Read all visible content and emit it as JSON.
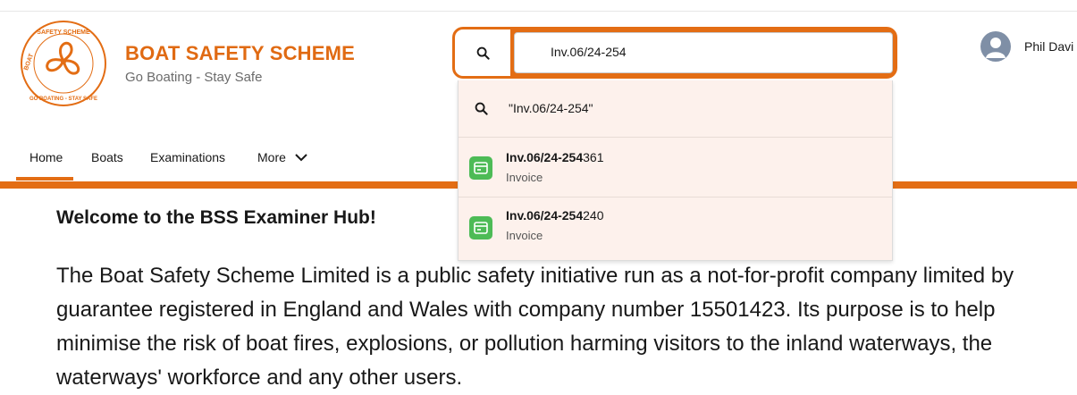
{
  "brand": {
    "title": "BOAT SAFETY SCHEME",
    "subtitle": "Go Boating - Stay Safe",
    "logo_text_top": "SAFETY SCHEME",
    "logo_text_left": "BOAT",
    "logo_text_bottom": "GO BOATING - STAY SAFE",
    "accent_color": "#e36d14"
  },
  "search": {
    "value": "Inv.06/24-254",
    "scope_icon": "search-icon"
  },
  "dropdown": {
    "search_suggestion": "\"Inv.06/24-254\"",
    "results": [
      {
        "match": "Inv.06/24-254",
        "rest": "361",
        "type": "Invoice",
        "icon": "invoice-icon"
      },
      {
        "match": "Inv.06/24-254",
        "rest": "240",
        "type": "Invoice",
        "icon": "invoice-icon"
      }
    ]
  },
  "user": {
    "name": "Phil Davi"
  },
  "nav": {
    "items": [
      {
        "label": "Home"
      },
      {
        "label": "Boats"
      },
      {
        "label": "Examinations"
      },
      {
        "label": "More"
      }
    ]
  },
  "content": {
    "welcome": "Welcome to the BSS Examiner Hub!",
    "paragraph": "The Boat Safety Scheme Limited is a public safety initiative run as a not-for-profit company limited by guarantee registered in England and Wales with company number 15501423. Its purpose is to help minimise the risk of boat fires, explosions, or pollution harming visitors to the inland waterways, the waterways' workforce and any other users."
  }
}
